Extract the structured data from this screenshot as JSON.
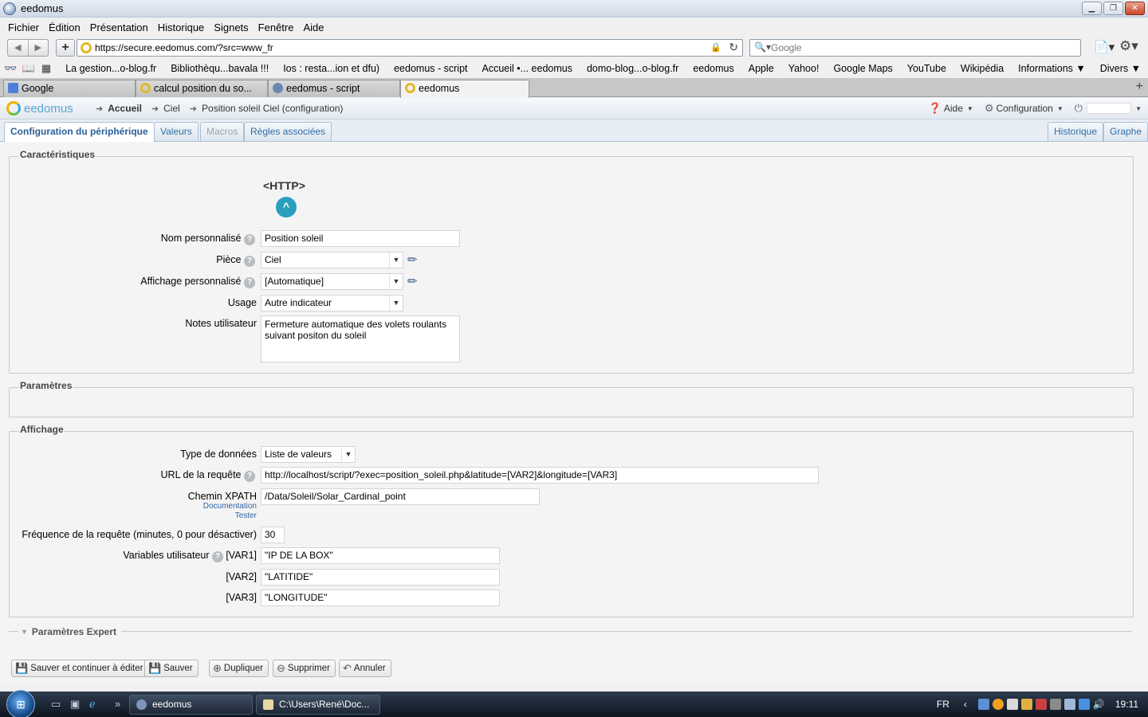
{
  "window": {
    "title": "eedomus"
  },
  "menu": [
    "Fichier",
    "Édition",
    "Présentation",
    "Historique",
    "Signets",
    "Fenêtre",
    "Aide"
  ],
  "nav": {
    "url": "https://secure.eedomus.com/?src=www_fr",
    "search_placeholder": "Google"
  },
  "bookmarks": [
    "La gestion...o-blog.fr",
    "Bibliothèqu...bavala !!!",
    "Ios : resta...ion et dfu)",
    "eedomus - script",
    "Accueil •... eedomus",
    "domo-blog...o-blog.fr",
    "eedomus",
    "Apple",
    "Yahoo!",
    "Google Maps",
    "YouTube",
    "Wikipédia",
    "Informations ▼",
    "Divers ▼"
  ],
  "tabs": [
    "Google",
    "calcul position du so...",
    "eedomus - script",
    "eedomus"
  ],
  "app": {
    "logo": "eedomus",
    "breadcrumb": [
      "Accueil",
      "Ciel",
      "Position soleil Ciel (configuration)"
    ],
    "help": "Aide",
    "config": "Configuration"
  },
  "device_tabs": [
    "Configuration du périphérique",
    "Valeurs",
    "Macros",
    "Règles associées"
  ],
  "device_tabs_right": [
    "Historique",
    "Graphe"
  ],
  "characteristics": {
    "legend": "Caractéristiques",
    "type": "<HTTP>",
    "name_label": "Nom personnalisé",
    "name_value": "Position soleil",
    "room_label": "Pièce",
    "room_value": "Ciel",
    "display_label": "Affichage personnalisé",
    "display_value": "[Automatique]",
    "usage_label": "Usage",
    "usage_value": "Autre indicateur",
    "notes_label": "Notes utilisateur",
    "notes_value": "Fermeture automatique des volets roulants suivant positon du soleil"
  },
  "parameters": {
    "legend": "Paramètres"
  },
  "display": {
    "legend": "Affichage",
    "datatype_label": "Type de données",
    "datatype_value": "Liste de valeurs",
    "url_label": "URL de la requête",
    "url_value": "http://localhost/script/?exec=position_soleil.php&latitude=[VAR2]&longitude=[VAR3]",
    "xpath_label": "Chemin XPATH",
    "xpath_value": "/Data/Soleil/Solar_Cardinal_point",
    "doc_link": "Documentation",
    "test_link": "Tester",
    "freq_label": "Fréquence de la requête (minutes, 0 pour désactiver)",
    "freq_value": "30",
    "vars_label": "Variables utilisateur",
    "var1_label": "[VAR1]",
    "var1_value": "\"IP DE LA BOX\"",
    "var2_label": "[VAR2]",
    "var2_value": "\"LATITIDE\"",
    "var3_label": "[VAR3]",
    "var3_value": "\"LONGITUDE\""
  },
  "expert": {
    "legend": "Paramètres Expert"
  },
  "actions": [
    "Sauver et continuer à éditer",
    "Sauver",
    "Dupliquer",
    "Supprimer",
    "Annuler"
  ],
  "taskbar": {
    "tasks": [
      "eedomus",
      "C:\\Users\\René\\Doc..."
    ],
    "lang": "FR",
    "clock": "19:11"
  }
}
